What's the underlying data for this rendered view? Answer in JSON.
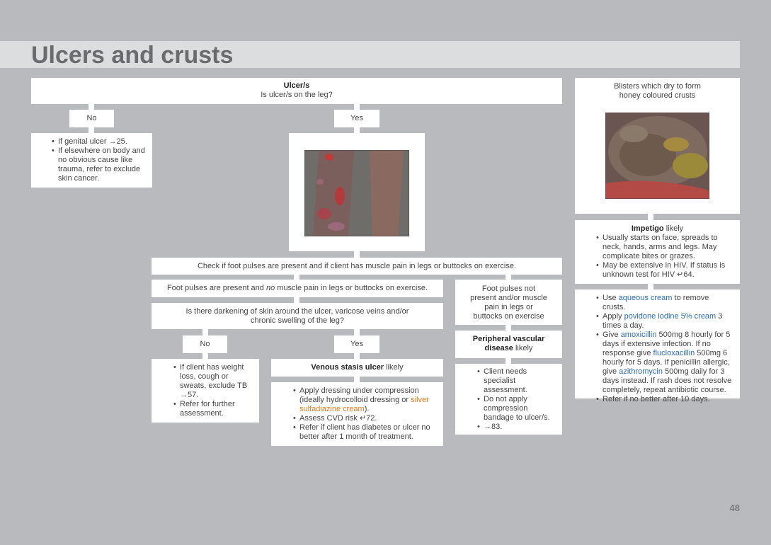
{
  "header": {
    "title": "Ulcers and crusts",
    "page_number": "48"
  },
  "ulcer": {
    "title": "Ulcer/s",
    "question": "Is ulcer/s on the leg?"
  },
  "no_label": "No",
  "yes_label": "Yes",
  "no_branch": {
    "items": [
      "If genital ulcer →25.",
      "If elsewhere on body and no obvious cause like trauma, refer to exclude skin cancer."
    ]
  },
  "check_pulses": "Check if foot pulses are present and if client has muscle pain in legs or buttocks on exercise.",
  "pulses_present": {
    "a": "Foot pulses are present and ",
    "b": "no",
    "c": " muscle pain in legs or buttocks on exercise."
  },
  "pulses_absent": "Foot pulses not present and/or muscle pain in legs or buttocks on exercise",
  "darkening_q": "Is there darkening of skin around the ulcer, varicose veins and/or chronic swelling of the leg?",
  "sub_no": {
    "items": [
      "If client has weight loss, cough or sweats, exclude TB →57.",
      "Refer for further assessment."
    ]
  },
  "venous": {
    "name": "Venous stasis ulcer",
    "likely": " likely"
  },
  "venous_mgmt": {
    "item1_a": "Apply dressing under compression (ideally hydrocolloid dressing or ",
    "item1_drug": "silver sulfadiazine cream",
    "item1_b": ").",
    "item2": "Assess CVD risk ↵72.",
    "item3": "Refer if client has diabetes or ulcer no better after 1 month of treatment."
  },
  "pvd": {
    "name": "Peripheral vascular disease",
    "likely": " likely"
  },
  "pvd_mgmt": {
    "items": [
      "Client needs specialist assessment.",
      "Do not apply compression bandage to ulcer/s.",
      "→83."
    ]
  },
  "blisters": "Blisters which dry to form honey coloured crusts",
  "impetigo": {
    "name": "Impetigo",
    "likely": " likely",
    "item1": "Usually starts on face, spreads to neck, hands, arms and legs. May complicate bites or grazes.",
    "item2": "May be extensive in HIV. If status is unknown test for HIV ↵64."
  },
  "impetigo_mgmt": {
    "i1a": "Use ",
    "i1d": "aqueous cream",
    "i1b": " to remove crusts.",
    "i2a": "Apply ",
    "i2d": "povidone iodine 5% cream",
    "i2b": " 3 times a day.",
    "i3a": "Give ",
    "i3d": "amoxicillin",
    "i3b": " 500mg 8 hourly for 5 days if extensive infection. If no response give ",
    "i3d2": "flucloxacillin",
    "i3c": " 500mg 6 hourly for 5 days. If penicillin allergic, give ",
    "i3d3": "azithromycin",
    "i3e": " 500mg daily for 3 days instead. If rash does not resolve completely, repeat antibiotic course.",
    "i4": "Refer if no better after 10 days."
  },
  "colors": {
    "drug": "#2a6cb0",
    "topical_drug": "#e07a1f",
    "background": "#b9babd"
  }
}
